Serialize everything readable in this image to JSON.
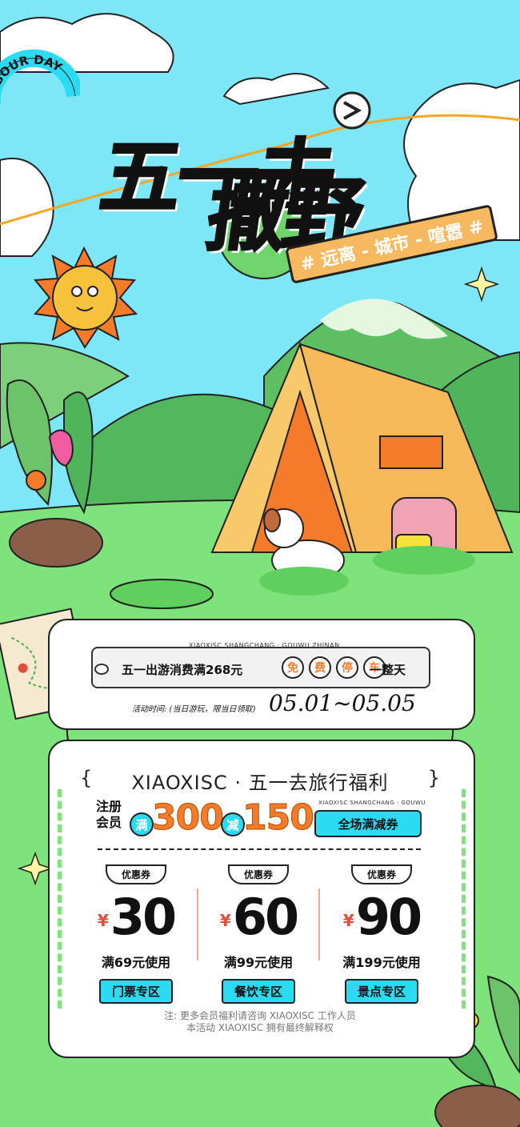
{
  "colors": {
    "sky": "#7de6f7",
    "grass": "#7ee37a",
    "accent_orange": "#f47b29",
    "accent_cyan": "#2bdbf2",
    "tent": "#f5c96b"
  },
  "header": {
    "badge": "LABOUR DAY",
    "title_line1": "五一去",
    "title_line2": "撒野",
    "tagline": "# 远离 - 城市 - 喧嚣 #"
  },
  "promo": {
    "tiny_caption": "XIAOXISC SHANGCHANG · GOUWU ZHINAN",
    "left_text": "五一出游消费满268元",
    "free_chars": [
      "免",
      "费",
      "停",
      "车"
    ],
    "right_text": "一整天",
    "activity_label": "活动时间: (当日游玩，限当日领取)",
    "dates": "05.01~05.05"
  },
  "benefits": {
    "heading_open": "{",
    "heading": "XIAOXISC · 五一去旅行福利",
    "heading_close": "}",
    "reg_line1": "注册",
    "reg_line2": "会员",
    "man_badge": "满",
    "amount_full": "300",
    "jian_badge": "减",
    "amount_off": "150",
    "tiny_caption": "XIAOXISC SHANGCHANG · GOUWU",
    "tag": "全场满减券",
    "coupons": [
      {
        "tag": "优惠券",
        "currency": "¥",
        "value": "30",
        "condition": "满69元使用",
        "zone": "门票专区"
      },
      {
        "tag": "优惠券",
        "currency": "¥",
        "value": "60",
        "condition": "满99元使用",
        "zone": "餐饮专区"
      },
      {
        "tag": "优惠券",
        "currency": "¥",
        "value": "90",
        "condition": "满199元使用",
        "zone": "景点专区"
      }
    ],
    "note_line1": "注:  更多会员福利请咨询 XIAOXISC 工作人员",
    "note_line2": "本活动 XIAOXISC 拥有最终解释权"
  }
}
